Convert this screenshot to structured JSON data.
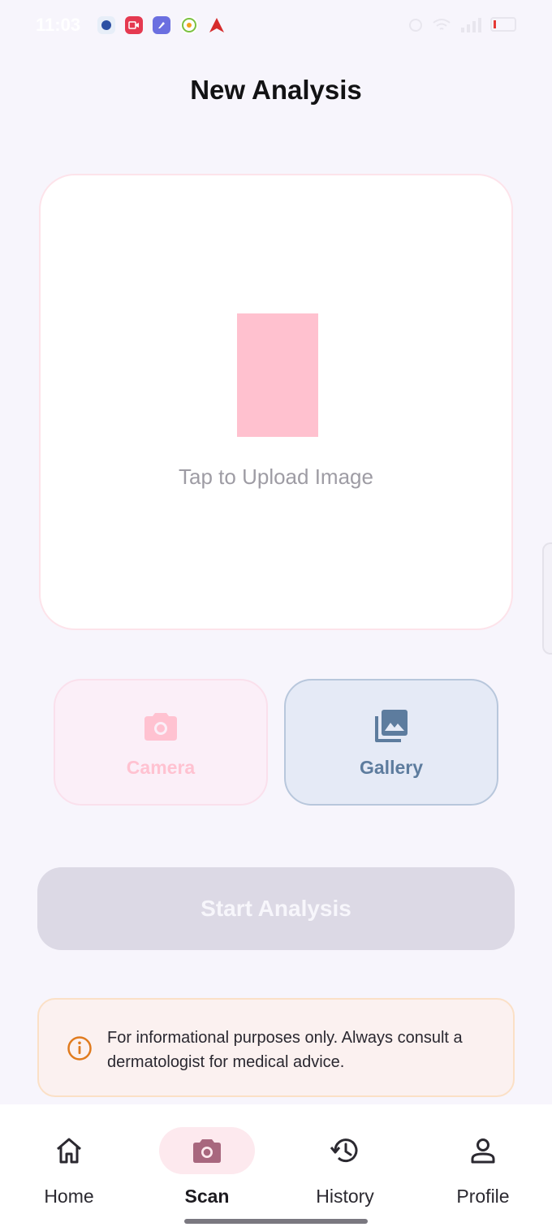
{
  "status_bar": {
    "time": "11:03"
  },
  "page_title": "New Analysis",
  "upload": {
    "label": "Tap to Upload Image"
  },
  "sources": {
    "camera_label": "Camera",
    "gallery_label": "Gallery"
  },
  "start_button_label": "Start Analysis",
  "disclaimer": {
    "text": "For informational purposes only. Always consult a dermatologist for medical advice."
  },
  "nav": {
    "items": [
      {
        "label": "Home",
        "icon": "home-icon"
      },
      {
        "label": "Scan",
        "icon": "camera-icon",
        "active": true
      },
      {
        "label": "History",
        "icon": "history-icon"
      },
      {
        "label": "Profile",
        "icon": "person-icon"
      }
    ]
  },
  "colors": {
    "accent": "#a8677e",
    "gallery_accent": "#5d7c9e",
    "warning": "#e07b1e"
  }
}
